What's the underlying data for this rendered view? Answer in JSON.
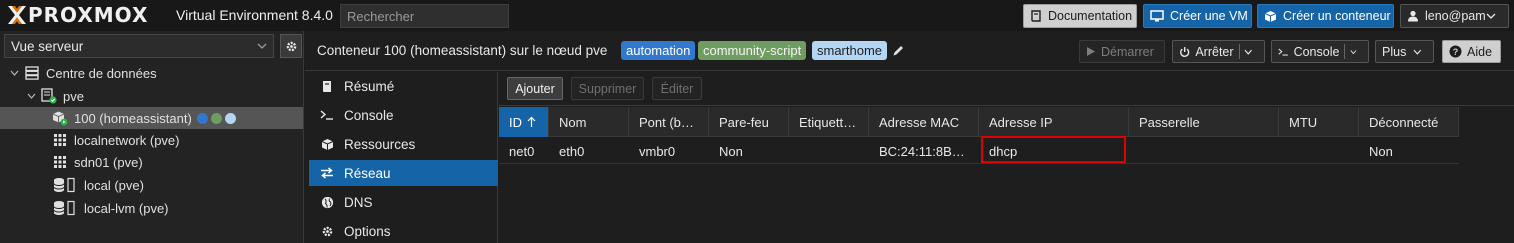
{
  "topbar": {
    "logo_text": "PROXMOX",
    "version": "Virtual Environment 8.4.0",
    "search_placeholder": "Rechercher",
    "doc_label": "Documentation",
    "create_vm_label": "Créer une VM",
    "create_ct_label": "Créer un conteneur",
    "user_label": "leno@pam"
  },
  "tree": {
    "view": "Vue serveur",
    "items": [
      {
        "label": "Centre de données",
        "icon": "server-rack-icon"
      },
      {
        "label": "pve",
        "icon": "node-icon"
      },
      {
        "label": "100 (homeassistant)",
        "icon": "container-icon"
      },
      {
        "label": "localnetwork (pve)",
        "icon": "grid-icon"
      },
      {
        "label": "sdn01 (pve)",
        "icon": "grid-icon"
      },
      {
        "label": "local (pve)",
        "icon": "storage-icon"
      },
      {
        "label": "local-lvm (pve)",
        "icon": "storage-icon"
      }
    ],
    "tag_colors": [
      "#3179cf",
      "#6e9c61",
      "#b3d6f5"
    ]
  },
  "header": {
    "title": "Conteneur 100 (homeassistant) sur le nœud pve",
    "tags": [
      {
        "label": "automation",
        "color": "#3179cf"
      },
      {
        "label": "community-script",
        "color": "#6e9c61"
      },
      {
        "label": "smarthome",
        "color": "#b3d6f5"
      }
    ],
    "start_label": "Démarrer",
    "stop_label": "Arrêter",
    "console_label": "Console",
    "more_label": "Plus",
    "help_label": "Aide"
  },
  "nav": {
    "items": [
      {
        "label": "Résumé",
        "icon": "book-icon"
      },
      {
        "label": "Console",
        "icon": "terminal-icon"
      },
      {
        "label": "Ressources",
        "icon": "cube-icon"
      },
      {
        "label": "Réseau",
        "icon": "exchange-icon"
      },
      {
        "label": "DNS",
        "icon": "globe-icon"
      },
      {
        "label": "Options",
        "icon": "gear-icon"
      }
    ],
    "active": "Réseau"
  },
  "toolbar": {
    "add_label": "Ajouter",
    "delete_label": "Supprimer",
    "edit_label": "Éditer"
  },
  "grid": {
    "columns": [
      "ID",
      "Nom",
      "Pont (b…",
      "Pare-feu",
      "Etiquett…",
      "Adresse MAC",
      "Adresse IP",
      "Passerelle",
      "MTU",
      "Déconnecté"
    ],
    "sorted_column": "ID",
    "rows": [
      [
        "net0",
        "eth0",
        "vmbr0",
        "Non",
        "",
        "BC:24:11:8B…",
        "dhcp",
        "",
        "",
        "Non"
      ]
    ]
  },
  "colors": {
    "accent": "#1664a8",
    "highlight_box": "#e00000",
    "status_green": "#2db84d",
    "logo_orange": "#e57000"
  }
}
